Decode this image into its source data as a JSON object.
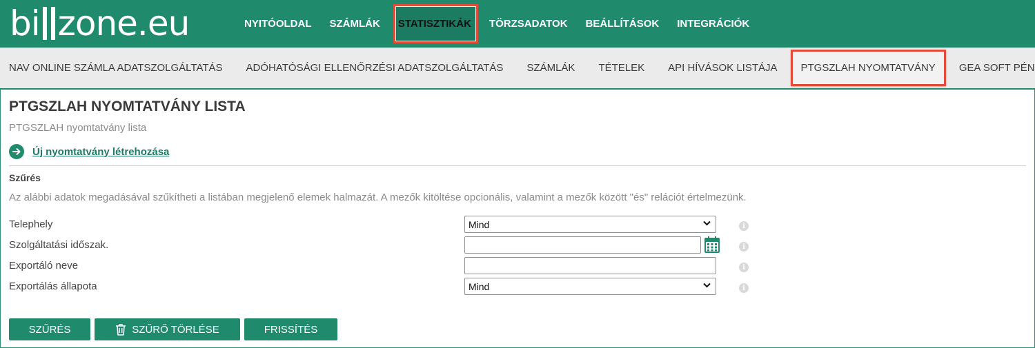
{
  "logo": {
    "left": "bi",
    "right": "zone.eu"
  },
  "topnav": [
    {
      "label": "NYITÓOLDAL"
    },
    {
      "label": "SZÁMLÁK"
    },
    {
      "label": "STATISZTIKÁK",
      "active": true
    },
    {
      "label": "TÖRZSADATOK"
    },
    {
      "label": "BEÁLLÍTÁSOK"
    },
    {
      "label": "INTEGRÁCIÓK"
    }
  ],
  "subnav": [
    {
      "label": "NAV ONLINE SZÁMLA ADATSZOLGÁLTATÁS"
    },
    {
      "label": "ADÓHATÓSÁGI ELLENŐRZÉSI ADATSZOLGÁLTATÁS"
    },
    {
      "label": "SZÁMLÁK"
    },
    {
      "label": "TÉTELEK"
    },
    {
      "label": "API HÍVÁSOK LISTÁJA"
    },
    {
      "label": "PTGSZLAH NYOMTATVÁNY",
      "active": true
    },
    {
      "label": "GEA SOFT PÉNZTÁRGÉP"
    }
  ],
  "page": {
    "title": "PTGSZLAH NYOMTATVÁNY LISTA",
    "subtitle": "PTGSZLAH nyomtatvány lista",
    "new_link": "Új nyomtatvány létrehozása"
  },
  "filter": {
    "title": "Szűrés",
    "description": "Az alábbi adatok megadásával szűkítheti a listában megjelenő elemek halmazát. A mezők kitöltése opcionális, valamint a mezők között \"és\" relációt értelmezünk.",
    "fields": {
      "telephely": {
        "label": "Telephely",
        "value": "Mind"
      },
      "idoszak": {
        "label": "Szolgáltatási időszak.",
        "value": ""
      },
      "exportalo": {
        "label": "Exportáló neve",
        "value": ""
      },
      "allapot": {
        "label": "Exportálás állapota",
        "value": "Mind"
      }
    },
    "info_glyph": "i"
  },
  "buttons": {
    "filter": "SZŰRÉS",
    "clear": "SZŰRŐ TÖRLÉSE",
    "refresh": "FRISSÍTÉS"
  },
  "colors": {
    "brand": "#1f8a6c",
    "highlight": "#e24c3a",
    "subbar": "#ebebeb"
  }
}
